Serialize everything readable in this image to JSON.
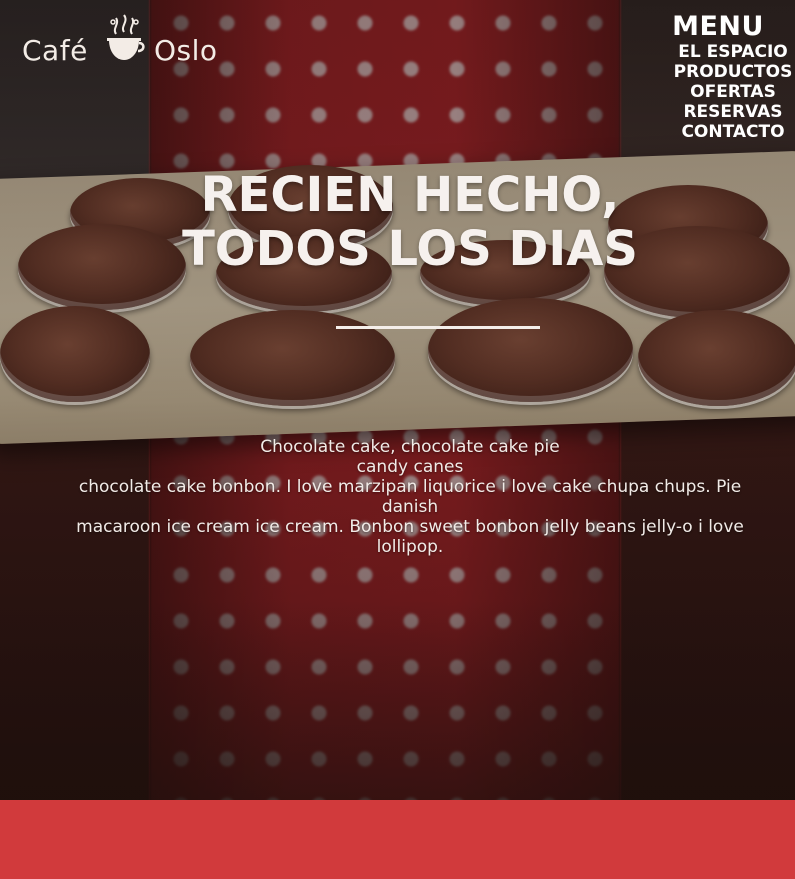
{
  "brand": {
    "name_left": "Café",
    "name_right": "Oslo",
    "cup_icon": "coffee-cup-icon"
  },
  "nav": {
    "title": "MENU",
    "items": [
      {
        "label": "EL ESPACIO"
      },
      {
        "label": "PRODUCTOS"
      },
      {
        "label": "OFERTAS"
      },
      {
        "label": "RESERVAS"
      },
      {
        "label": "CONTACTO"
      }
    ]
  },
  "hero": {
    "headline_line1": "RECIEN HECHO,",
    "headline_line2": "TODOS LOS DIAS",
    "body_line1": "Chocolate cake, chocolate cake pie",
    "body_line2": "candy canes",
    "body_line3": "chocolate cake bonbon. I love marzipan liquorice i love cake chupa chups. Pie danish",
    "body_line4": "macaroon ice cream ice cream. Bonbon sweet bonbon jelly beans jelly-o i love lollipop."
  },
  "colors": {
    "accent": "#d13a3c",
    "apron_red": "#b2242a",
    "text_light": "#f6f1ee"
  }
}
